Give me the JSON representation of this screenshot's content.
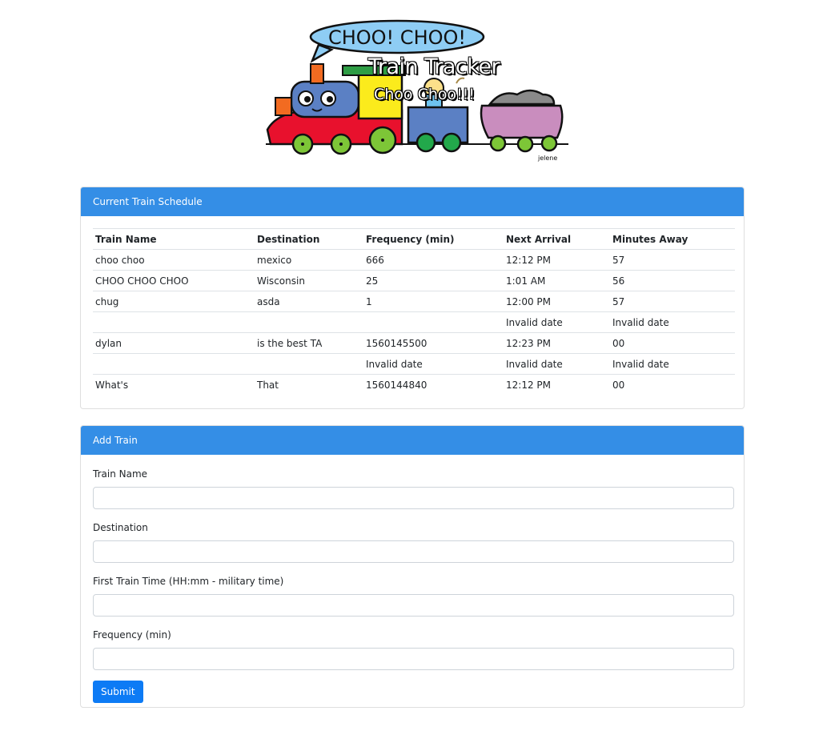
{
  "hero": {
    "bubble_text": "CHOO! CHOO!",
    "title": "Train Tracker",
    "subtitle": "Choo Choo!!!",
    "signature": "jelene"
  },
  "schedule": {
    "header": "Current Train Schedule",
    "columns": [
      "Train Name",
      "Destination",
      "Frequency (min)",
      "Next Arrival",
      "Minutes Away"
    ],
    "rows": [
      [
        "choo choo",
        "mexico",
        "666",
        "12:12 PM",
        "57"
      ],
      [
        "CHOO CHOO CHOO",
        "Wisconsin",
        "25",
        "1:01 AM",
        "56"
      ],
      [
        "chug",
        "asda",
        "1",
        "12:00 PM",
        "57"
      ],
      [
        "",
        "",
        "",
        "Invalid date",
        "Invalid date"
      ],
      [
        "dylan",
        "is the best TA",
        "1560145500",
        "12:23 PM",
        "00"
      ],
      [
        "",
        "",
        "Invalid date",
        "Invalid date",
        "Invalid date"
      ],
      [
        "What's",
        "That",
        "1560144840",
        "12:12 PM",
        "00"
      ]
    ]
  },
  "add_train": {
    "header": "Add Train",
    "fields": [
      {
        "label": "Train Name",
        "value": ""
      },
      {
        "label": "Destination",
        "value": ""
      },
      {
        "label": "First Train Time (HH:mm - military time)",
        "value": ""
      },
      {
        "label": "Frequency (min)",
        "value": ""
      }
    ],
    "submit_label": "Submit"
  },
  "colors": {
    "header_blue": "#348ee6",
    "button_blue": "#0d7bf5"
  }
}
